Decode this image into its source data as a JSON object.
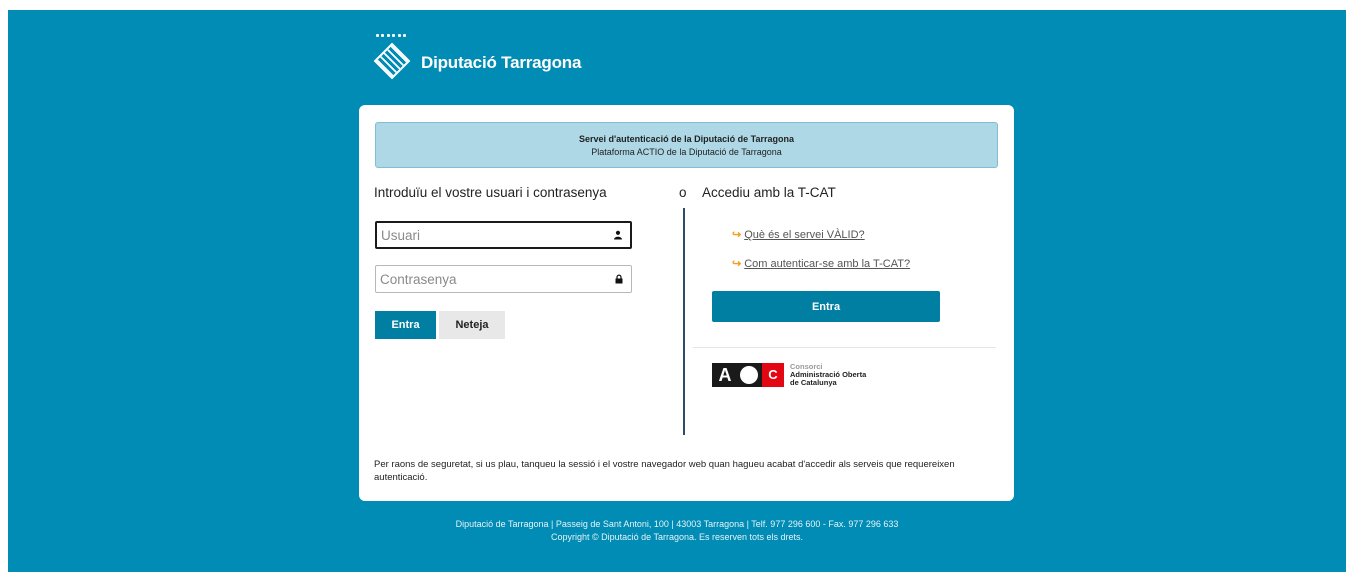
{
  "brand": {
    "name": "Diputació Tarragona",
    "background_color": "#008cb4",
    "accent_button_color": "#007fa3"
  },
  "banner": {
    "title": "Servei d'autenticació de la Diputació de Tarragona",
    "subtitle": "Plataforma ACTIO de la Diputació de Tarragona"
  },
  "login": {
    "heading": "Introduïu el vostre usuari i contrasenya",
    "username_placeholder": "Usuari",
    "username_value": "",
    "password_placeholder": "Contrasenya",
    "password_value": "",
    "user_icon": "user-icon",
    "lock_icon": "lock-icon",
    "submit_label": "Entra",
    "clear_label": "Neteja"
  },
  "or_label": "o",
  "tcat": {
    "heading": "Accediu amb la T-CAT",
    "links": [
      {
        "arrow": "↪",
        "label": "Què és el servei VÀLID?"
      },
      {
        "arrow": "↪",
        "label": "Com autenticar-se amb la T-CAT?"
      }
    ],
    "submit_label": "Entra",
    "aoc": {
      "letters": {
        "a": "A",
        "c": "C"
      },
      "line1": "Consorci",
      "line2": "Administració Oberta",
      "line3": "de Catalunya"
    }
  },
  "notice": "Per raons de seguretat, si us plau, tanqueu la sessió i el vostre navegador web quan hagueu acabat d'accedir als serveis que requereixen autenticació.",
  "footer": {
    "line1": "Diputació de Tarragona | Passeig de Sant Antoni, 100 | 43003 Tarragona | Telf. 977 296 600 - Fax. 977 296 633",
    "line2": "Copyright © Diputació de Tarragona. Es reserven tots els drets."
  }
}
